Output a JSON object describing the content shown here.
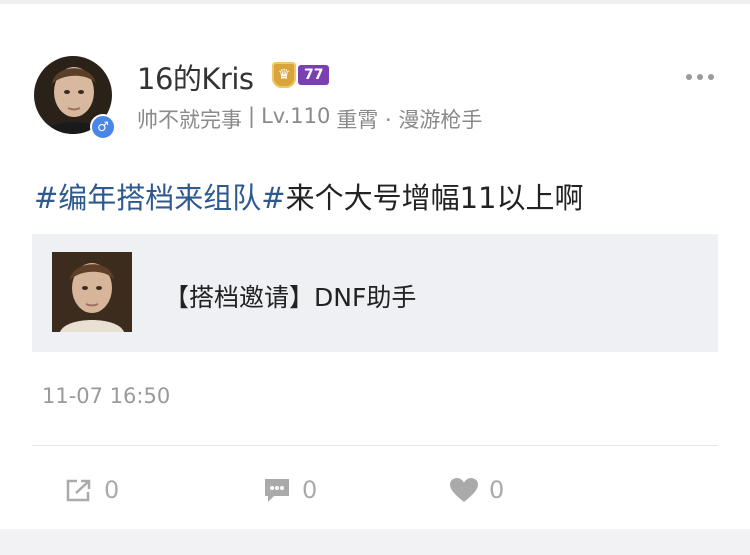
{
  "user": {
    "name": "16的Kris",
    "vip_level": "77",
    "meta": [
      "帅不就完事",
      "|",
      "Lv.110",
      "重霄 · 漫游枪手"
    ],
    "gender_symbol": "♂"
  },
  "post": {
    "topic": "#编年搭档来组队#",
    "text": "来个大号增幅11以上啊",
    "timestamp": "11-07 16:50"
  },
  "share_card": {
    "title": "【搭档邀请】DNF助手"
  },
  "actions": {
    "repost_count": "0",
    "comment_count": "0",
    "like_count": "0"
  },
  "icons": {
    "more": "more-horizontal-icon",
    "repost": "share-icon",
    "comment": "comment-icon",
    "like": "heart-icon",
    "vip": "vip-shield-icon",
    "gender": "male-icon"
  },
  "colors": {
    "topic": "#2e5a8f",
    "vip_purple": "#7a3fb0",
    "vip_gold": "#d9a43a",
    "gender_blue": "#4a86e8"
  }
}
